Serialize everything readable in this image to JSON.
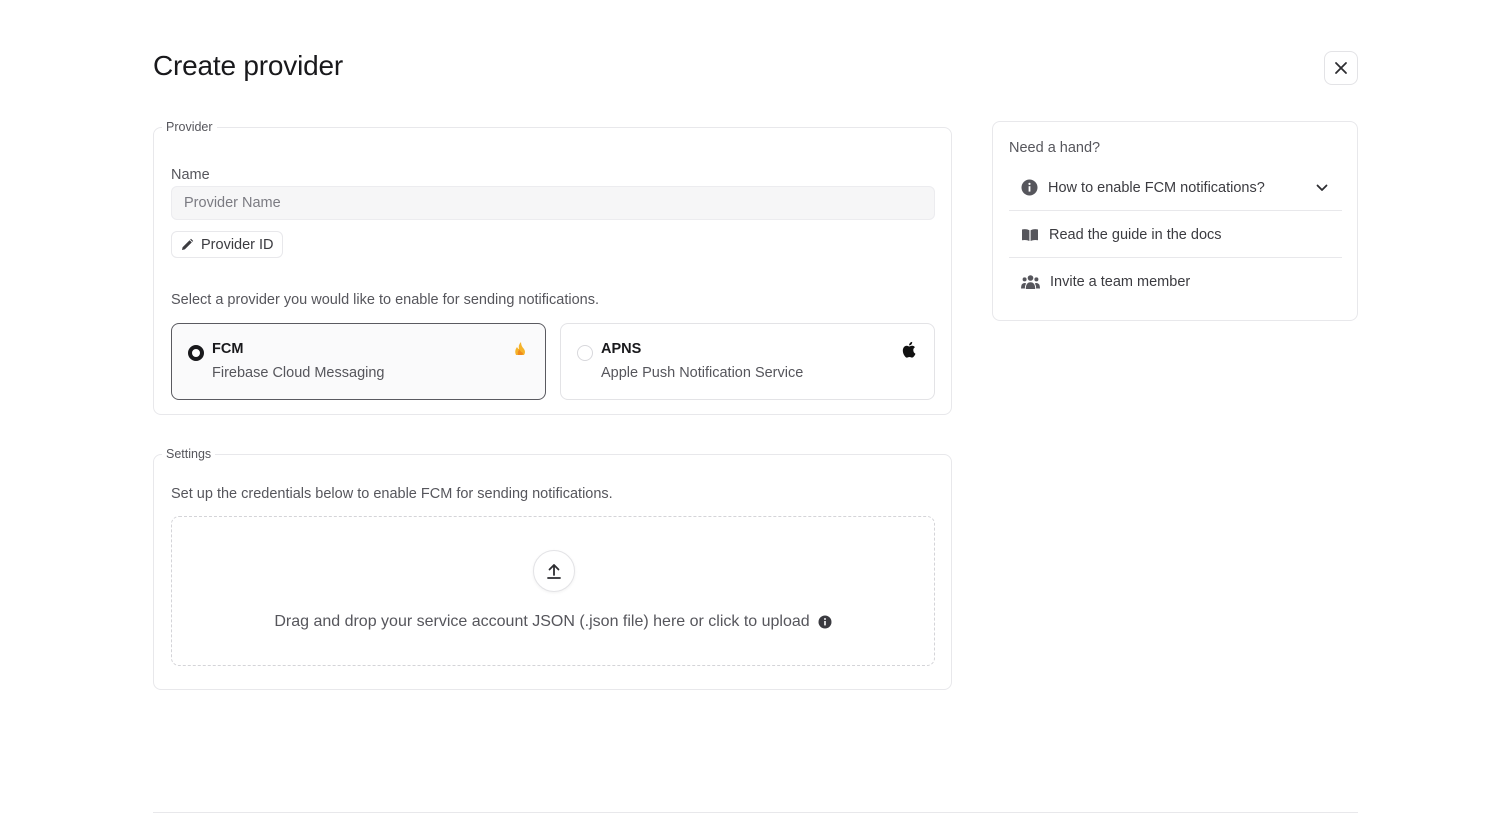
{
  "header": {
    "title": "Create provider",
    "close_icon": "close-icon"
  },
  "provider_section": {
    "legend": "Provider",
    "name_label": "Name",
    "name_input": {
      "placeholder": "Provider Name",
      "value": ""
    },
    "provider_id_button": {
      "label": "Provider ID",
      "icon": "pencil-icon"
    },
    "select_prompt": "Select a provider you would like to enable for sending notifications.",
    "options": [
      {
        "title": "FCM",
        "subtitle": "Firebase Cloud Messaging",
        "selected": true,
        "icon": "firebase-icon"
      },
      {
        "title": "APNS",
        "subtitle": "Apple Push Notification Service",
        "selected": false,
        "icon": "apple-icon"
      }
    ]
  },
  "settings_section": {
    "legend": "Settings",
    "description": "Set up the credentials below to enable FCM for sending notifications.",
    "dropzone": {
      "text": "Drag and drop your service account JSON (.json file) here or click to upload",
      "upload_icon": "upload-icon",
      "info_icon": "info-icon"
    }
  },
  "help": {
    "title": "Need a hand?",
    "items": [
      {
        "label": "How to enable FCM notifications?",
        "icon": "info-icon",
        "expandable": true
      },
      {
        "label": "Read the guide in the docs",
        "icon": "book-icon"
      },
      {
        "label": "Invite a team member",
        "icon": "team-icon"
      }
    ]
  },
  "colors": {
    "accent": "#19191c",
    "firebase_orange": "#f5a623",
    "muted_text": "#56565c",
    "border": "#e8e8eb"
  }
}
